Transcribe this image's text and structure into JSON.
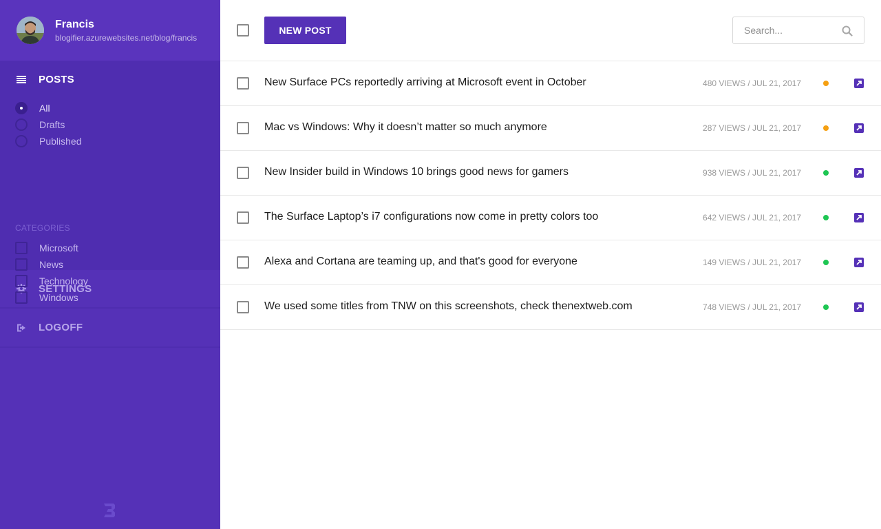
{
  "user": {
    "name": "Francis",
    "url": "blogifier.azurewebsites.net/blog/francis"
  },
  "sidebar": {
    "posts_label": "POSTS",
    "filters": [
      {
        "label": "All",
        "checked": true
      },
      {
        "label": "Drafts",
        "checked": false
      },
      {
        "label": "Published",
        "checked": false
      }
    ],
    "categories_title": "CATEGORIES",
    "categories": [
      {
        "label": "Microsoft"
      },
      {
        "label": "News"
      },
      {
        "label": "Technology"
      },
      {
        "label": "Windows"
      }
    ],
    "settings_label": "SETTINGS",
    "logoff_label": "LOGOFF",
    "logo_icon": "blogifier-b-logo"
  },
  "toolbar": {
    "new_post_label": "NEW POST",
    "search_placeholder": "Search..."
  },
  "colors": {
    "accent": "#5531b7",
    "status_draft": "#f5a012",
    "status_published": "#1ec653"
  },
  "posts": [
    {
      "title": "New Surface PCs reportedly arriving at Microsoft event in October",
      "meta": "480 VIEWS / JUL 21, 2017",
      "status": "draft"
    },
    {
      "title": "Mac vs Windows: Why it doesn’t matter so much anymore",
      "meta": "287 VIEWS / JUL 21, 2017",
      "status": "draft"
    },
    {
      "title": "New Insider build in Windows 10 brings good news for gamers",
      "meta": "938 VIEWS / JUL 21, 2017",
      "status": "published"
    },
    {
      "title": "The Surface Laptop’s i7 configurations now come in pretty colors too",
      "meta": "642 VIEWS / JUL 21, 2017",
      "status": "published"
    },
    {
      "title": "Alexa and Cortana are teaming up, and that's good for everyone",
      "meta": "149 VIEWS / JUL 21, 2017",
      "status": "published"
    },
    {
      "title": "We used some titles from TNW on this screenshots, check thenextweb.com",
      "meta": "748 VIEWS / JUL 21, 2017",
      "status": "published"
    }
  ]
}
